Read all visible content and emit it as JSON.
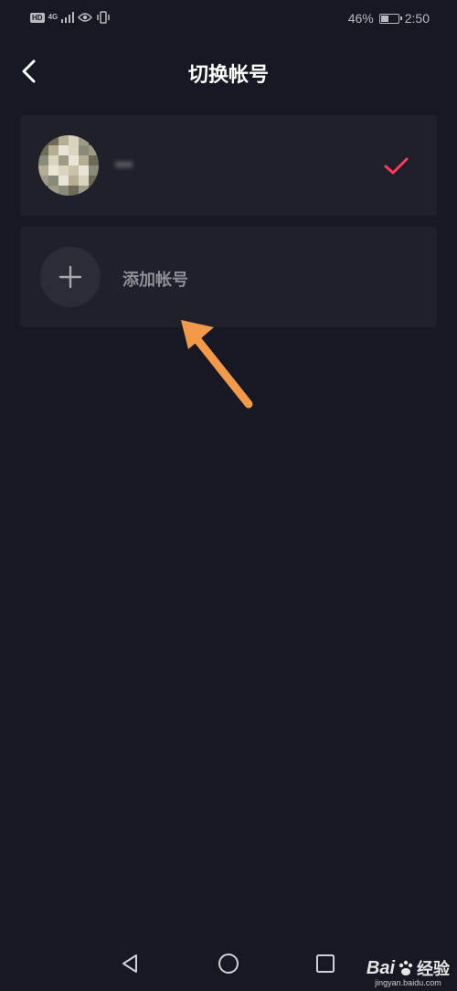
{
  "status_bar": {
    "hd_label": "HD",
    "network_label": "4G",
    "battery_text": "46%",
    "battery_level": 0.46,
    "time": "2:50"
  },
  "header": {
    "title": "切换帐号",
    "back_icon": "chevron-left-icon"
  },
  "accounts": [
    {
      "name": "•••",
      "selected": true,
      "check_color": "#ff3b5c"
    }
  ],
  "add_account": {
    "label": "添加帐号",
    "icon": "plus-icon"
  },
  "system_nav": {
    "back": "triangle-back-icon",
    "home": "circle-home-icon",
    "recents": "square-recents-icon"
  },
  "watermark": {
    "brand": "Bai",
    "brand_suffix": "经验",
    "url": "jingyan.baidu.com"
  },
  "colors": {
    "background": "#161823",
    "card": "#1f2029",
    "accent_check": "#ff3b5c",
    "annotation_arrow": "#f29a4a"
  }
}
